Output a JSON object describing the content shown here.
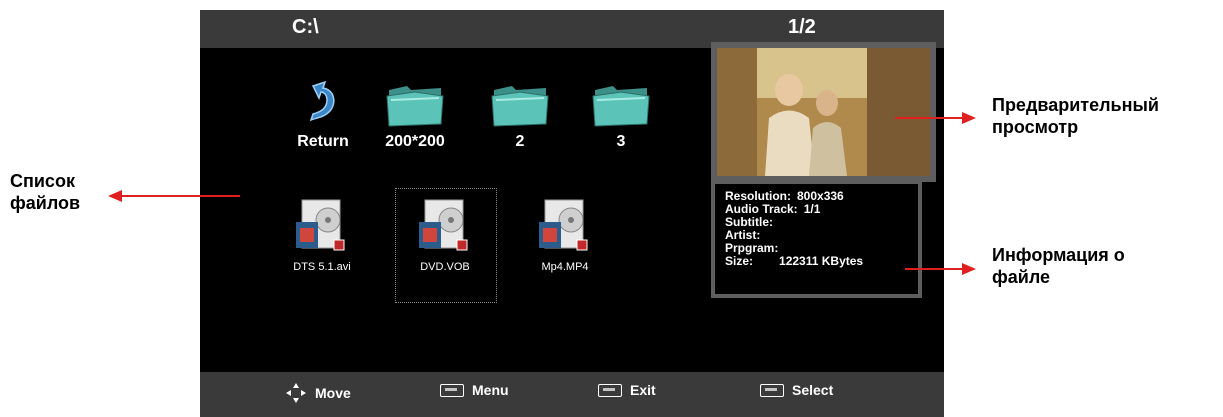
{
  "header": {
    "path": "C:\\",
    "page": "1/2"
  },
  "folders": [
    {
      "label": "Return",
      "icon": "return-icon"
    },
    {
      "label": "200*200",
      "icon": "folder-icon"
    },
    {
      "label": "2",
      "icon": "folder-icon"
    },
    {
      "label": "3",
      "icon": "folder-icon"
    }
  ],
  "files": [
    {
      "label": "DTS 5.1.avi",
      "icon": "video-file-icon"
    },
    {
      "label": "DVD.VOB",
      "icon": "video-file-icon",
      "selected": true
    },
    {
      "label": "Mp4.MP4",
      "icon": "video-file-icon"
    }
  ],
  "info": {
    "resolution_label": "Resolution:",
    "resolution_value": "800x336",
    "audio_label": "Audio Track:",
    "audio_value": "1/1",
    "subtitle_label": "Subtitle:",
    "artist_label": "Artist:",
    "program_label": "Prpgram:",
    "size_label": "Size:",
    "size_value": "122311 KBytes"
  },
  "footer": {
    "move": "Move",
    "menu": "Menu",
    "exit": "Exit",
    "select": "Select"
  },
  "annotations": {
    "file_list_line1": "Список",
    "file_list_line2": "файлов",
    "preview_line1": "Предварительный",
    "preview_line2": "просмотр",
    "info_line1": "Информация о",
    "info_line2": "файле"
  },
  "colors": {
    "screen_bg": "#000000",
    "bar_bg": "#3a3a3a",
    "frame": "#5e5e5e",
    "arrow": "#e02020"
  }
}
